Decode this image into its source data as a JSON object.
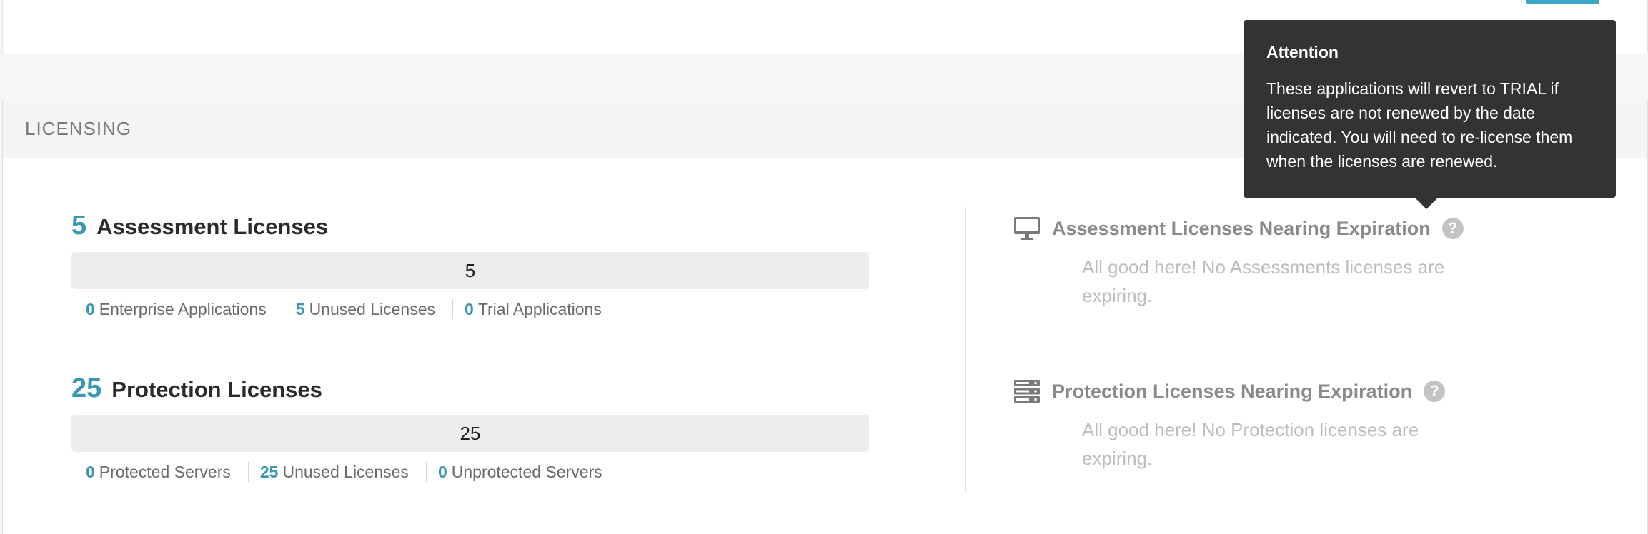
{
  "panel": {
    "title": "LICENSING"
  },
  "assessment": {
    "count": "5",
    "title": "Assessment Licenses",
    "bar_value": "5",
    "stats": [
      {
        "num": "0",
        "label": "Enterprise Applications"
      },
      {
        "num": "5",
        "label": "Unused Licenses"
      },
      {
        "num": "0",
        "label": "Trial Applications"
      }
    ],
    "expiration": {
      "icon": "monitor-icon",
      "title": "Assessment Licenses Nearing Expiration",
      "help": "?",
      "message": "All good here! No Assessments licenses are expiring."
    }
  },
  "protection": {
    "count": "25",
    "title": "Protection Licenses",
    "bar_value": "25",
    "stats": [
      {
        "num": "0",
        "label": "Protected Servers"
      },
      {
        "num": "25",
        "label": "Unused Licenses"
      },
      {
        "num": "0",
        "label": "Unprotected Servers"
      }
    ],
    "expiration": {
      "icon": "server-icon",
      "title": "Protection Licenses Nearing Expiration",
      "help": "?",
      "message": "All good here! No Protection licenses are expiring."
    }
  },
  "tooltip": {
    "title": "Attention",
    "body": "These applications will revert to TRIAL if licenses are not renewed by the date indicated. You will need to re-license them when the licenses are renewed."
  },
  "colors": {
    "accent": "#3a97b1",
    "tooltip_bg": "#333333"
  }
}
